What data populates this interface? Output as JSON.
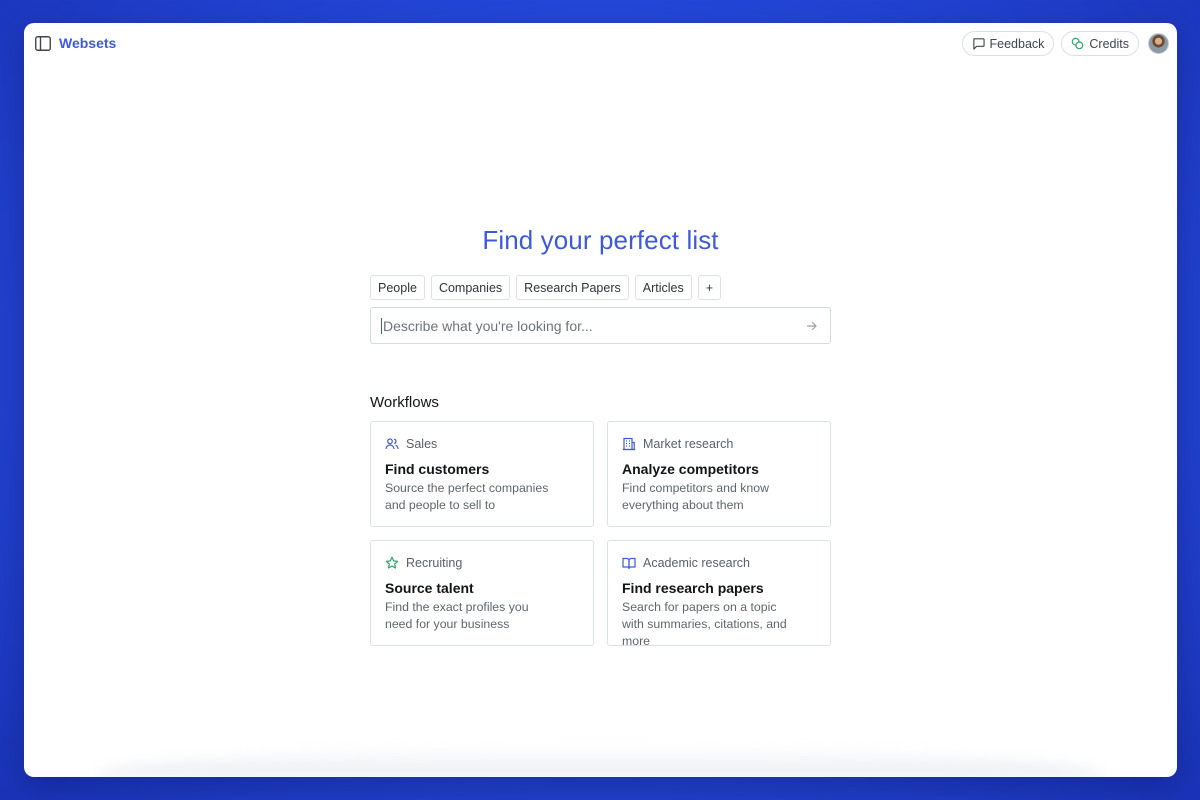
{
  "header": {
    "brand": "Websets",
    "feedback_label": "Feedback",
    "credits_label": "Credits"
  },
  "hero": {
    "title": "Find your perfect list"
  },
  "chips": [
    "People",
    "Companies",
    "Research Papers",
    "Articles",
    "+"
  ],
  "search": {
    "placeholder": "Describe what you're looking for..."
  },
  "workflows": {
    "heading": "Workflows",
    "cards": [
      {
        "category": "Sales",
        "icon": "users-icon",
        "title": "Find customers",
        "description": "Source the perfect companies and people to sell to"
      },
      {
        "category": "Market research",
        "icon": "building-icon",
        "title": "Analyze competitors",
        "description": "Find competitors and know everything about them"
      },
      {
        "category": "Recruiting",
        "icon": "star-icon",
        "title": "Source talent",
        "description": "Find the exact profiles you need for your business"
      },
      {
        "category": "Academic research",
        "icon": "book-open-icon",
        "title": "Find research papers",
        "description": "Search for papers on a topic with summaries, citations, and more"
      }
    ]
  },
  "colors": {
    "accent": "#3d5bd9",
    "background": "#2447d9",
    "credits_icon": "#2ea36a"
  }
}
